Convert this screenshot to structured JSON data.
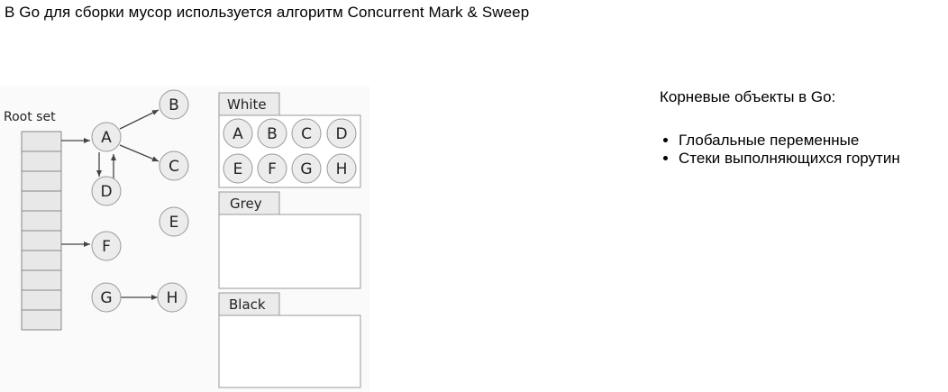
{
  "heading": "В Go для сборки мусор используется алгоритм Concurrent Mark & Sweep",
  "diagram": {
    "root_set_label": "Root set",
    "graph_nodes": [
      "A",
      "B",
      "C",
      "D",
      "E",
      "F",
      "G",
      "H"
    ],
    "sets": [
      {
        "label": "White",
        "members": [
          "A",
          "B",
          "C",
          "D",
          "E",
          "F",
          "G",
          "H"
        ]
      },
      {
        "label": "Grey",
        "members": []
      },
      {
        "label": "Black",
        "members": []
      }
    ]
  },
  "side": {
    "title": "Корневые объекты в Go:",
    "items": [
      "Глобальные переменные",
      "Стеки выполняющихся горутин"
    ]
  }
}
